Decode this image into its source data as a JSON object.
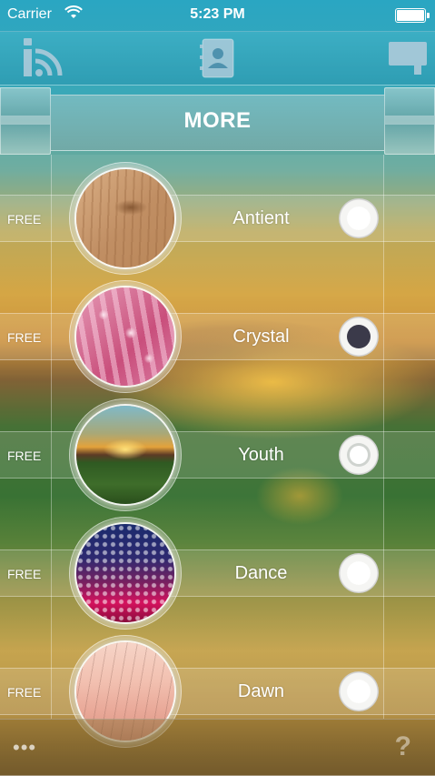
{
  "status_bar": {
    "carrier": "Carrier",
    "time": "5:23 PM"
  },
  "top_bar": {
    "left_icon": "info-rss-icon",
    "center_icon": "contact-card-icon",
    "right_icon": "message-board-icon"
  },
  "title": "MORE",
  "items": [
    {
      "price": "FREE",
      "name": "Antient",
      "thumb_icon": "wood-texture",
      "selected": false
    },
    {
      "price": "FREE",
      "name": "Crystal",
      "thumb_icon": "pink-crystal-beads",
      "selected": true
    },
    {
      "price": "FREE",
      "name": "Youth",
      "thumb_icon": "sunset-sunflowers",
      "selected": false
    },
    {
      "price": "FREE",
      "name": "Dance",
      "thumb_icon": "disco-dots",
      "selected": false
    },
    {
      "price": "FREE",
      "name": "Dawn",
      "thumb_icon": "pink-grass-dawn",
      "selected": false
    }
  ],
  "bottom_bar": {
    "more_label": "•••",
    "help_label": "?"
  },
  "colors": {
    "accent_top": "#2aa6c2",
    "radio_selected": "#3b3a4a",
    "radio_unselected": "#ffffff"
  }
}
